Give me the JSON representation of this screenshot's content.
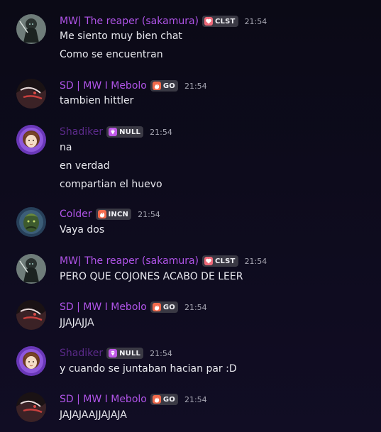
{
  "colors": {
    "background": "#0b0a16",
    "reaper_name": "#b054e8",
    "mebolo_name": "#b054e8",
    "shadiker_name": "#5b2a8a",
    "colder_name": "#b054e8",
    "badge_bg": "#3a3944",
    "timestamp": "#a7a7b3",
    "message_text": "#e8e8ee"
  },
  "messages": [
    {
      "author": "MW| The reaper (sakamura)",
      "badge_icon": "heart-icon",
      "badge": "CLST",
      "time": "21:54",
      "avatar_icon": "dark-reaper-avatar",
      "lines": [
        "Me siento muy bien chat",
        "Como se encuentran"
      ]
    },
    {
      "author": "SD | MW I Mebolo",
      "badge_icon": "fire-icon",
      "badge": "GO",
      "time": "21:54",
      "avatar_icon": "red-anime-avatar",
      "lines": [
        "tambien hittler"
      ]
    },
    {
      "author": "Shadiker",
      "badge_icon": "gem-icon",
      "badge": "NULL",
      "time": "21:54",
      "avatar_icon": "purple-girl-avatar",
      "lines": [
        "na",
        "en verdad",
        "compartian el huevo"
      ]
    },
    {
      "author": "Colder",
      "badge_icon": "fire-icon",
      "badge": "INCN",
      "time": "21:54",
      "avatar_icon": "green-warrior-avatar",
      "lines": [
        "Vaya dos"
      ]
    },
    {
      "author": "MW| The reaper (sakamura)",
      "badge_icon": "heart-icon",
      "badge": "CLST",
      "time": "21:54",
      "avatar_icon": "dark-reaper-avatar",
      "lines": [
        "PERO QUE COJONES ACABO DE LEER"
      ]
    },
    {
      "author": "SD | MW I Mebolo",
      "badge_icon": "fire-icon",
      "badge": "GO",
      "time": "21:54",
      "avatar_icon": "red-anime-avatar",
      "lines": [
        "JJAJAJJA"
      ]
    },
    {
      "author": "Shadiker",
      "badge_icon": "gem-icon",
      "badge": "NULL",
      "time": "21:54",
      "avatar_icon": "purple-girl-avatar",
      "lines": [
        "y cuando se juntaban hacian par :D"
      ]
    },
    {
      "author": "SD | MW I Mebolo",
      "badge_icon": "fire-icon",
      "badge": "GO",
      "time": "21:54",
      "avatar_icon": "red-anime-avatar",
      "lines": [
        "JAJAJAAJJAJAJA"
      ]
    }
  ]
}
